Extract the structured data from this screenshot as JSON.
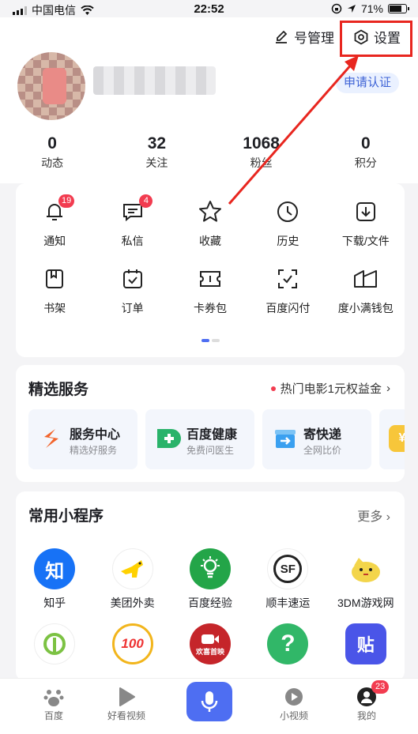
{
  "status_bar": {
    "carrier": "中国电信",
    "time": "22:52",
    "battery": "71%"
  },
  "header": {
    "account_manage": "号管理",
    "settings": "设置",
    "verify": "申请认证",
    "stats": [
      {
        "num": "0",
        "label": "动态"
      },
      {
        "num": "32",
        "label": "关注"
      },
      {
        "num": "1068",
        "label": "粉丝"
      },
      {
        "num": "0",
        "label": "积分"
      }
    ]
  },
  "grid": [
    {
      "label": "通知",
      "badge": "19",
      "icon": "bell-icon"
    },
    {
      "label": "私信",
      "badge": "4",
      "icon": "message-icon"
    },
    {
      "label": "收藏",
      "badge": "",
      "icon": "star-icon"
    },
    {
      "label": "历史",
      "badge": "",
      "icon": "clock-icon"
    },
    {
      "label": "下载/文件",
      "badge": "",
      "icon": "download-icon"
    },
    {
      "label": "书架",
      "badge": "",
      "icon": "bookshelf-icon"
    },
    {
      "label": "订单",
      "badge": "",
      "icon": "order-icon"
    },
    {
      "label": "卡券包",
      "badge": "",
      "icon": "ticket-icon"
    },
    {
      "label": "百度闪付",
      "badge": "",
      "icon": "scan-pay-icon"
    },
    {
      "label": "度小满钱包",
      "badge": "",
      "icon": "wallet-icon"
    }
  ],
  "services": {
    "title": "精选服务",
    "promo": "热门电影1元权益金",
    "items": [
      {
        "title": "服务中心",
        "sub": "精选好服务",
        "color": "#f2642b"
      },
      {
        "title": "百度健康",
        "sub": "免费问医生",
        "color": "#29b36a"
      },
      {
        "title": "寄快递",
        "sub": "全网比价",
        "color": "#3aa0f0"
      }
    ]
  },
  "apps": {
    "title": "常用小程序",
    "more": "更多",
    "items": [
      {
        "label": "知乎",
        "glyph": "知",
        "color": "#1772f6"
      },
      {
        "label": "美团外卖",
        "glyph": "",
        "color": "#ffd100"
      },
      {
        "label": "百度经验",
        "glyph": "",
        "color": "#23a548"
      },
      {
        "label": "顺丰速运",
        "glyph": "SF",
        "color": "#222222"
      },
      {
        "label": "3DM游戏网",
        "glyph": "",
        "color": "#f3d54b"
      },
      {
        "label": "",
        "glyph": "",
        "color": "#7cc243"
      },
      {
        "label": "",
        "glyph": "100",
        "color": "#f2b51c"
      },
      {
        "label": "",
        "glyph": "欢喜首映",
        "color": "#c5252a"
      },
      {
        "label": "",
        "glyph": "?",
        "color": "#31b768"
      },
      {
        "label": "",
        "glyph": "贴",
        "color": "#4a55e8"
      }
    ]
  },
  "tabbar": {
    "home": "百度",
    "video": "好看视频",
    "short_video": "小视频",
    "mine": "我的",
    "mine_badge": "23"
  }
}
